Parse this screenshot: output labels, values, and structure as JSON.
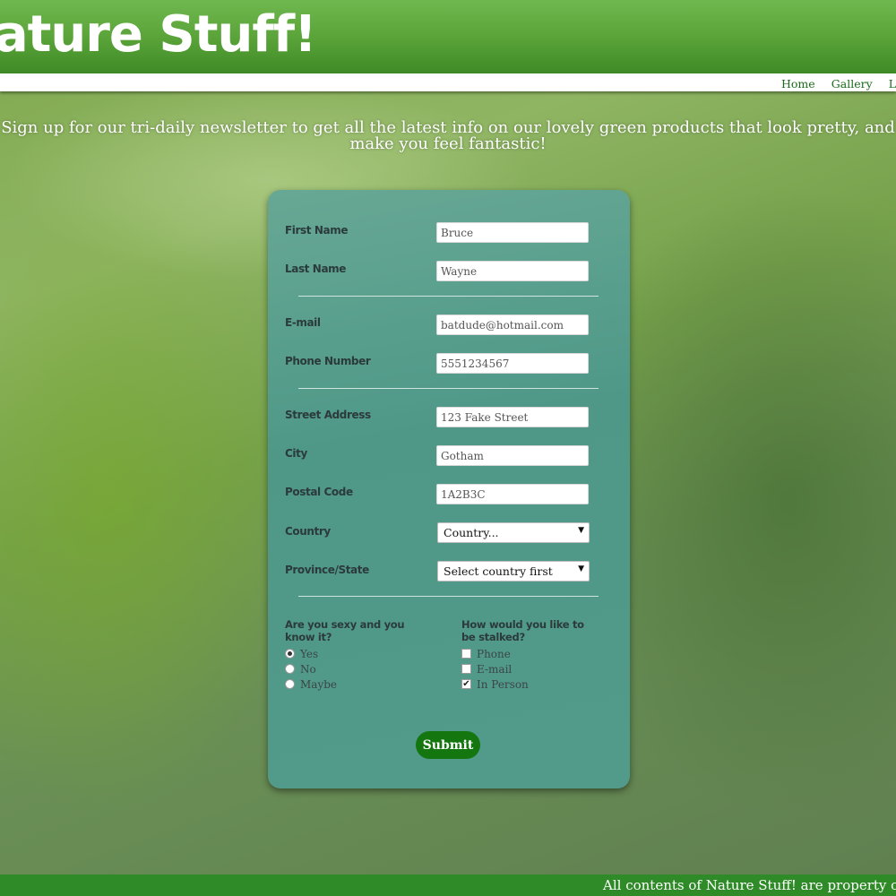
{
  "header": {
    "logo_text": "Nature Stuff!"
  },
  "nav": {
    "home": "Home",
    "gallery": "Gallery",
    "login": "Login"
  },
  "intro": "Sign up for our tri-daily newsletter to get all the latest info on our lovely green products that look pretty, and make you feel fantastic!",
  "form": {
    "first_name": {
      "label": "First Name",
      "value": "Bruce"
    },
    "last_name": {
      "label": "Last Name",
      "value": "Wayne"
    },
    "email": {
      "label": "E-mail",
      "value": "batdude@hotmail.com"
    },
    "phone": {
      "label": "Phone Number",
      "value": "5551234567"
    },
    "street": {
      "label": "Street Address",
      "value": "123 Fake Street"
    },
    "city": {
      "label": "City",
      "value": "Gotham"
    },
    "postal": {
      "label": "Postal Code",
      "value": "1A2B3C"
    },
    "country": {
      "label": "Country",
      "selected": "Country..."
    },
    "province": {
      "label": "Province/State",
      "selected": "Select country first"
    },
    "sexy_question": {
      "label": "Are you sexy and you know it?",
      "options": [
        {
          "label": "Yes",
          "checked": true
        },
        {
          "label": "No",
          "checked": false
        },
        {
          "label": "Maybe",
          "checked": false
        }
      ]
    },
    "stalk_question": {
      "label": "How would you like to be stalked?",
      "options": [
        {
          "label": "Phone",
          "checked": false
        },
        {
          "label": "E-mail",
          "checked": false
        },
        {
          "label": "In Person",
          "checked": true
        }
      ]
    },
    "submit_label": "Submit"
  },
  "footer": {
    "text": "All contents of Nature Stuff! are property of ©Ha"
  },
  "colors": {
    "header_green": "#5aa43a",
    "form_teal": "#529a8a",
    "submit_green": "#13760f",
    "footer_green": "#2f8a28",
    "nav_link": "#1a6b1a"
  }
}
